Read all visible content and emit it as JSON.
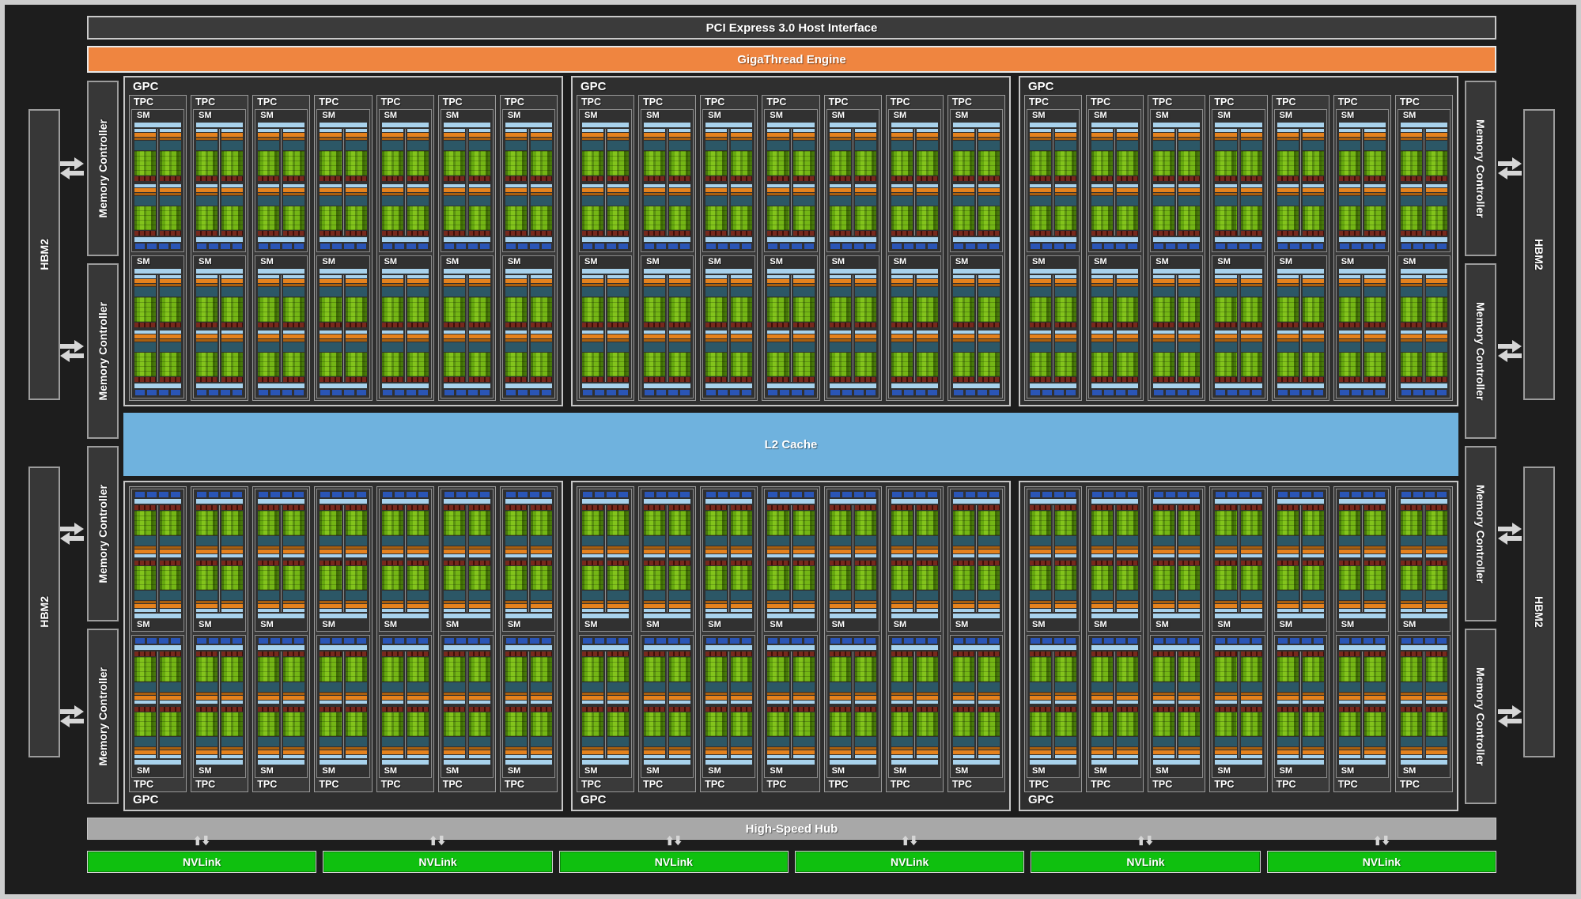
{
  "diagram": {
    "bars": {
      "pci": "PCI Express 3.0 Host Interface",
      "gigathread": "GigaThread Engine",
      "l2_cache": "L2 Cache",
      "high_speed_hub": "High-Speed Hub",
      "nvlink": "NVLink"
    },
    "labels": {
      "gpc": "GPC",
      "tpc": "TPC",
      "sm": "SM",
      "hbm2": "HBM2",
      "memory_controller": "Memory Controller"
    },
    "structure": {
      "gpc_rows": 2,
      "gpcs_per_row": 3,
      "tpcs_per_gpc": 7,
      "sms_per_tpc": 2,
      "processing_blocks_per_sm": 4,
      "texture_segments_per_sm": 4,
      "nvlink_blocks": 6,
      "memory_controllers_per_side": 4,
      "hbm2_stacks_per_side": 2
    },
    "colors": {
      "background": "#1d1d1d",
      "panel_gray": "#3b3b3b",
      "gigathread_orange": "#ef8540",
      "l2_blue": "#6fb2de",
      "hub_gray": "#a8a8a8",
      "nvlink_green": "#0fc00f",
      "sm_light_blue": "#a8d2ec",
      "sm_scheduler_orange": "#e5821d",
      "sm_dispatch_orange": "#a95f0f",
      "sm_register_teal": "#2c5766",
      "sm_core_green_light": "#83c41c",
      "sm_core_green_dark": "#47790a",
      "sm_ldst_red": "#77291d",
      "sm_tex_blue": "#2a55b6",
      "arrow_gray": "#d6d6d6"
    }
  }
}
